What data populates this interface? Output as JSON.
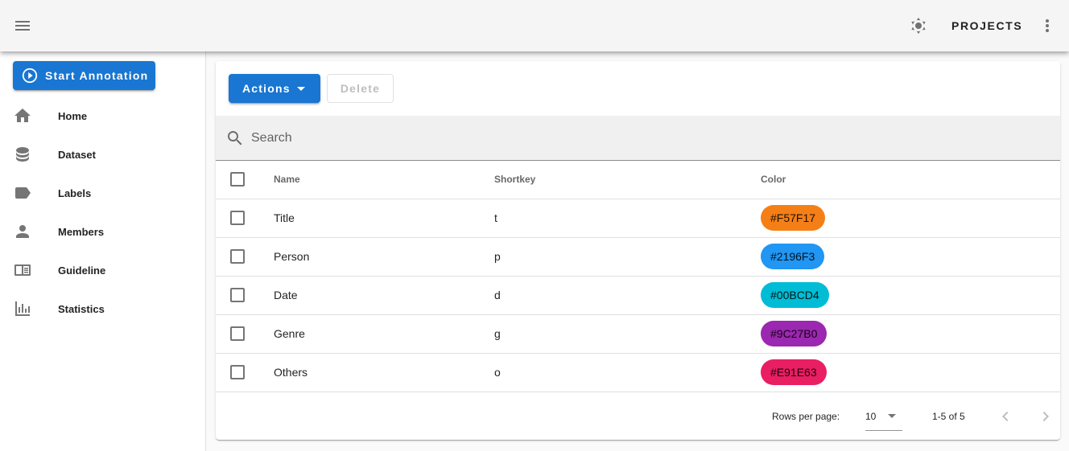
{
  "appbar": {
    "menu_icon": "menu-icon",
    "theme_icon": "brightness-icon",
    "projects_label": "PROJECTS",
    "more_icon": "dots-vertical-icon"
  },
  "sidebar": {
    "start_label": "Start Annotation",
    "items": [
      {
        "label": "Home",
        "icon": "home-icon"
      },
      {
        "label": "Dataset",
        "icon": "database-icon"
      },
      {
        "label": "Labels",
        "icon": "label-icon"
      },
      {
        "label": "Members",
        "icon": "account-icon"
      },
      {
        "label": "Guideline",
        "icon": "book-open-icon"
      },
      {
        "label": "Statistics",
        "icon": "chart-bar-icon"
      }
    ]
  },
  "toolbar": {
    "actions_label": "Actions",
    "delete_label": "Delete"
  },
  "search": {
    "placeholder": "Search",
    "value": ""
  },
  "table": {
    "headers": [
      "Name",
      "Shortkey",
      "Color"
    ],
    "rows": [
      {
        "name": "Title",
        "shortkey": "t",
        "color": "#F57F17"
      },
      {
        "name": "Person",
        "shortkey": "p",
        "color": "#2196F3"
      },
      {
        "name": "Date",
        "shortkey": "d",
        "color": "#00BCD4"
      },
      {
        "name": "Genre",
        "shortkey": "g",
        "color": "#9C27B0"
      },
      {
        "name": "Others",
        "shortkey": "o",
        "color": "#E91E63"
      }
    ]
  },
  "footer": {
    "rows_per_page_label": "Rows per page:",
    "rows_per_page_value": "10",
    "range_text": "1-5 of 5"
  },
  "colors": {
    "primary": "#1976d2",
    "appbar_bg": "#f5f5f5"
  }
}
